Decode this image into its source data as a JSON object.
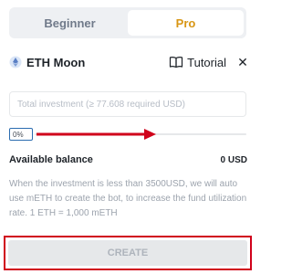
{
  "mode_toggle": {
    "beginner_label": "Beginner",
    "pro_label": "Pro",
    "selected": "Pro"
  },
  "header": {
    "icon": "eth-icon",
    "title": "ETH Moon",
    "tutorial_icon": "book-icon",
    "tutorial_label": "Tutorial",
    "close_icon": "close-icon",
    "close_glyph": "✕"
  },
  "investment": {
    "value": "",
    "placeholder": "Total investment (≥ 77.608 required USD)"
  },
  "slider": {
    "percent_label": "0%",
    "value_percent": 0
  },
  "balance": {
    "label": "Available balance",
    "value": "0 USD"
  },
  "info_text": "When the investment is less than 3500USD, we will auto use mETH to create the bot, to increase the fund utilization rate. 1 ETH = 1,000 mETH",
  "create_button": {
    "label": "CREATE",
    "enabled": false
  },
  "colors": {
    "accent": "#d89614",
    "annotation": "#d0021b",
    "text_primary": "#1e2329",
    "text_muted": "#9ca3ad"
  }
}
